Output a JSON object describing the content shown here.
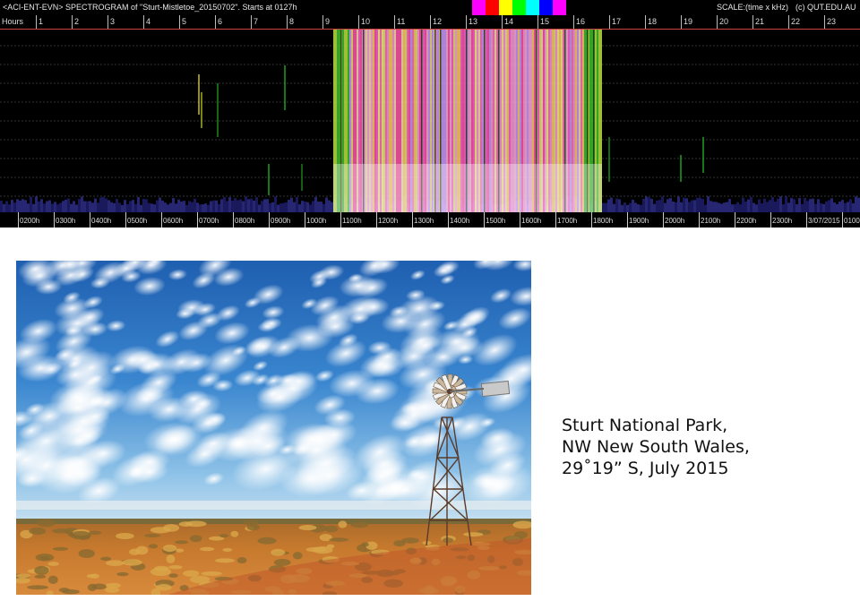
{
  "spectrogram": {
    "title": "<ACI-ENT-EVN> SPECTROGRAM  of \"Sturt-Mistletoe_20150702\".   Starts at 0127h",
    "scale_label": "SCALE:(time x kHz)",
    "copyright": "(c) QUT.EDU.AU",
    "hours_label": "Hours",
    "hour_ticks": [
      "1",
      "2",
      "3",
      "4",
      "5",
      "6",
      "7",
      "8",
      "9",
      "10",
      "11",
      "12",
      "13",
      "14",
      "15",
      "16",
      "17",
      "18",
      "19",
      "20",
      "21",
      "22",
      "23"
    ],
    "time_labels": [
      "0200h",
      "0300h",
      "0400h",
      "0500h",
      "0600h",
      "0700h",
      "0800h",
      "0900h",
      "1000h",
      "1100h",
      "1200h",
      "1300h",
      "1400h",
      "1500h",
      "1600h",
      "1700h",
      "1800h",
      "1900h",
      "2000h",
      "2100h",
      "2200h",
      "2300h",
      "3/07/2015",
      "0100"
    ],
    "swatch_colors": [
      "#ff00ff",
      "#ff0000",
      "#ffff00",
      "#00ff00",
      "#00ffff",
      "#0000ff",
      "#ff00ff"
    ]
  },
  "caption": {
    "line1": "Sturt National Park,",
    "line2": "NW New South Wales,",
    "line3": "29˚19” S, July 2015"
  }
}
